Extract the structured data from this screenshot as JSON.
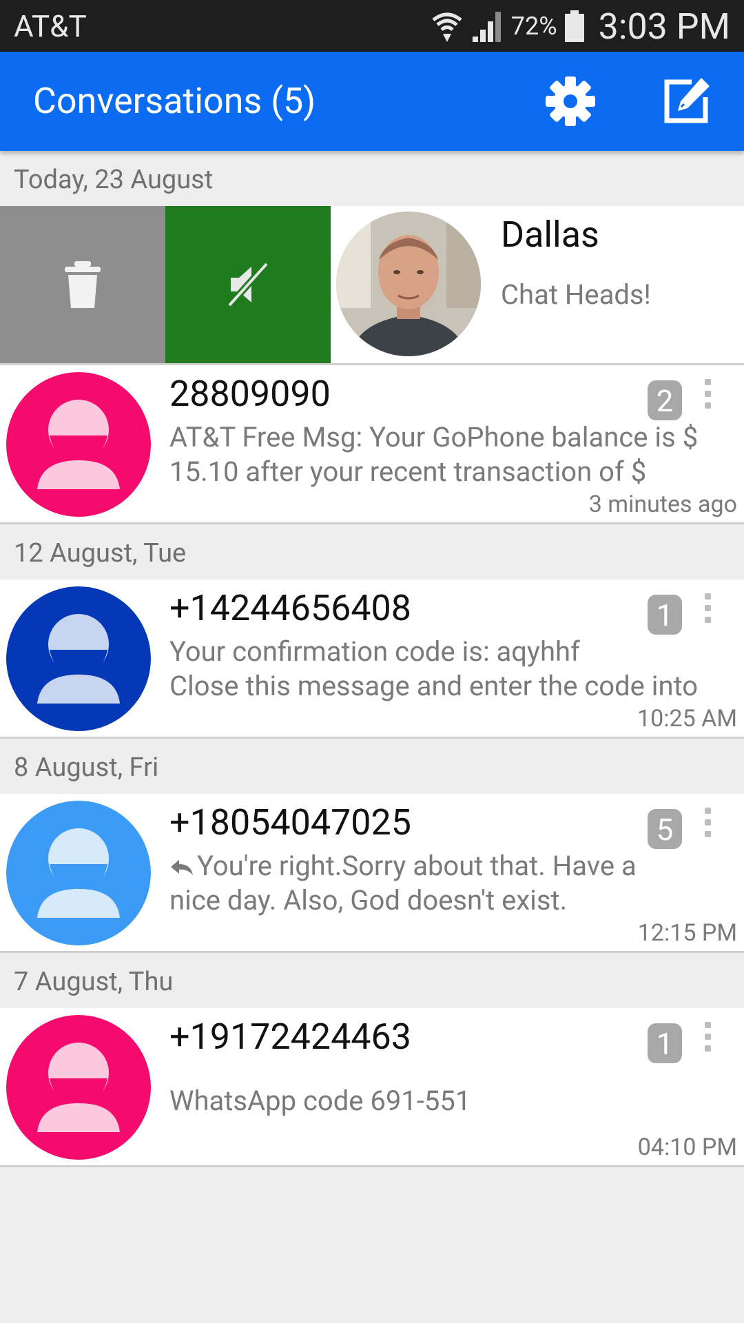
{
  "status_bar": {
    "carrier": "AT&T",
    "battery": "72%",
    "time": "3:03 PM"
  },
  "action_bar": {
    "title": "Conversations (5)",
    "settings_icon": "gear-icon",
    "compose_icon": "compose-icon",
    "color": "#0b6cf2"
  },
  "sections": [
    {
      "header": "Today, 23 August",
      "swiped": {
        "name": "Dallas",
        "snippet": "Chat Heads!",
        "delete_icon": "trash-icon",
        "mute_icon": "mute-icon"
      },
      "conversations": [
        {
          "name": "28809090",
          "badge": "2",
          "snippet_lines": [
            "AT&T Free Msg: Your GoPhone balance is $",
            "15.10 after your recent transaction of $"
          ],
          "time": "3 minutes ago",
          "avatar_color": "#f50a6e"
        }
      ]
    },
    {
      "header": "12 August, Tue",
      "conversations": [
        {
          "name": "+14244656408",
          "badge": "1",
          "snippet_lines": [
            "Your confirmation code is: aqyhhf",
            "Close this message and enter the code into"
          ],
          "time": "10:25 AM",
          "avatar_color": "#0438b6"
        }
      ]
    },
    {
      "header": "8 August, Fri",
      "conversations": [
        {
          "name": "+18054047025",
          "badge": "5",
          "snippet_lines": [
            "You're right.Sorry about that.  Have a",
            "nice day. Also, God doesn't exist."
          ],
          "time": "12:15 PM",
          "avatar_color": "#3c9cf5",
          "reply_icon": "reply-icon"
        }
      ]
    },
    {
      "header": "7 August, Thu",
      "conversations": [
        {
          "name": "+19172424463",
          "badge": "1",
          "snippet_lines": [
            "",
            "WhatsApp code 691-551"
          ],
          "time": "04:10 PM",
          "avatar_color": "#f50a6e"
        }
      ]
    }
  ]
}
